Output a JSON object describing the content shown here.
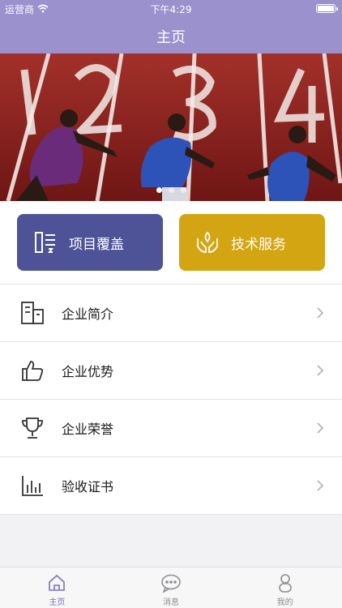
{
  "status_bar": {
    "carrier": "运营商",
    "time": "下午4:29"
  },
  "nav": {
    "title": "主页"
  },
  "banner": {
    "slide_count": 3,
    "active_slide": 1
  },
  "quick_actions": [
    {
      "label": "项目覆盖",
      "icon": "document-list-icon",
      "color": "#4e5397"
    },
    {
      "label": "技术服务",
      "icon": "hands-leaf-icon",
      "color": "#d4a513"
    }
  ],
  "menu": {
    "items": [
      {
        "label": "企业简介",
        "icon": "building-icon"
      },
      {
        "label": "企业优势",
        "icon": "thumbs-up-icon"
      },
      {
        "label": "企业荣誉",
        "icon": "trophy-icon"
      },
      {
        "label": "验收证书",
        "icon": "bar-chart-icon"
      }
    ]
  },
  "tabbar": {
    "tabs": [
      {
        "label": "主页",
        "icon": "home-icon",
        "active": true
      },
      {
        "label": "消息",
        "icon": "chat-icon",
        "active": false
      },
      {
        "label": "我的",
        "icon": "person-icon",
        "active": false
      }
    ]
  },
  "colors": {
    "header": "#9a91cd",
    "active_tab": "#7b70c2"
  }
}
